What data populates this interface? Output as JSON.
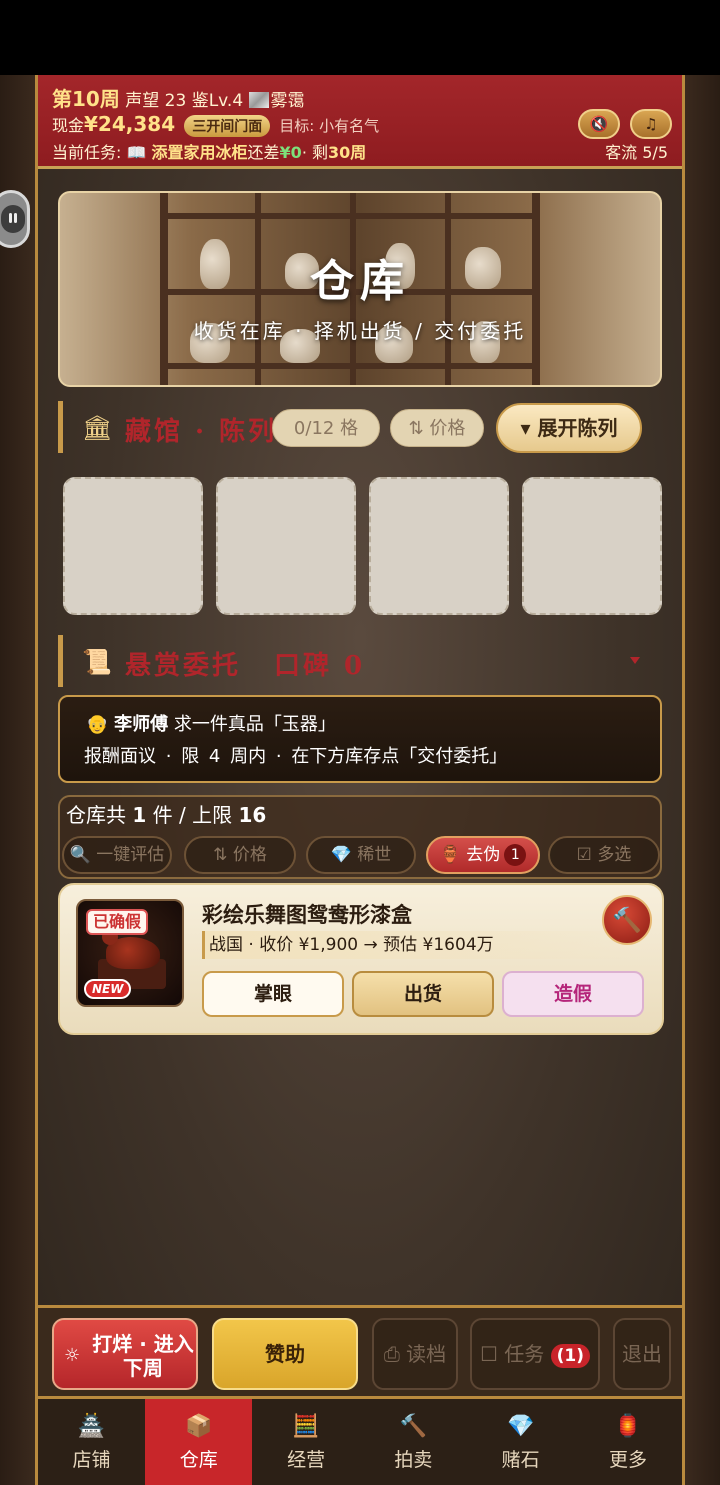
{
  "header": {
    "week": "第10周",
    "reputation": "声望 23",
    "appraise": "鉴Lv.4",
    "weather": "雾霭",
    "cash_label": "现金",
    "cash": "¥24,384",
    "shop_level": "三开间门面",
    "target": "目标: 小有名气",
    "task_label": "当前任务:",
    "task_name": "添置家用冰柜",
    "task_remain": "还差",
    "task_amount": "¥0",
    "task_weeks_prefix": "· 剩",
    "task_weeks": "30周",
    "traffic": "客流 5/5",
    "mute_icon": "🔇",
    "music_icon": "♫"
  },
  "banner": {
    "title": "仓库",
    "subtitle": "收货在库 · 择机出货 / 交付委托"
  },
  "collection": {
    "icon": "🏛",
    "title": "藏馆 · 陈列",
    "slots_label": "0/12 格",
    "sort_label": "⇅ 价格",
    "expand_label": "▾ 展开陈列",
    "slot_count": 4
  },
  "bounty": {
    "icon": "📜",
    "title": "悬赏委托",
    "reputation": "口碑 0",
    "client_icon": "👴",
    "client": "李师傅",
    "request": "求一件真品「玉器」",
    "reward": "报酬面议",
    "limit": "限 4 周内",
    "hint": "在下方库存点「交付委托」",
    "sep": "·"
  },
  "inventory": {
    "count_prefix": "仓库共",
    "count": "1",
    "count_mid": "件 / 上限",
    "limit": "16",
    "filters": {
      "appraise": "🔍 一键评估",
      "price": "⇅ 价格",
      "rare": "稀世",
      "rare_icon": "💎",
      "fake": "去伪",
      "fake_icon": "🏺",
      "fake_count": "1",
      "multi": "☑ 多选"
    }
  },
  "item": {
    "tag": "已确假",
    "new": "NEW",
    "name": "彩绘乐舞图鸳鸯形漆盒",
    "meta": "战国 · 收价 ¥1,900 → 预估 ¥1604万",
    "hammer_icon": "🔨",
    "btn_view": "掌眼",
    "btn_sell": "出货",
    "btn_fake": "造假"
  },
  "actions": {
    "next_icon": "☼",
    "next_week": "打烊 · 进入下周",
    "sponsor": "赞助",
    "load": "读档",
    "load_icon": "⎙",
    "task": "任务",
    "task_icon": "☐",
    "task_count": "(1)",
    "exit": "退出"
  },
  "nav": [
    {
      "label": "店铺",
      "icon": "🏯"
    },
    {
      "label": "仓库",
      "icon": "📦"
    },
    {
      "label": "经营",
      "icon": "🧮"
    },
    {
      "label": "拍卖",
      "icon": "🔨"
    },
    {
      "label": "赌石",
      "icon": "💎"
    },
    {
      "label": "更多",
      "icon": "🏮"
    }
  ],
  "nav_active": 1
}
